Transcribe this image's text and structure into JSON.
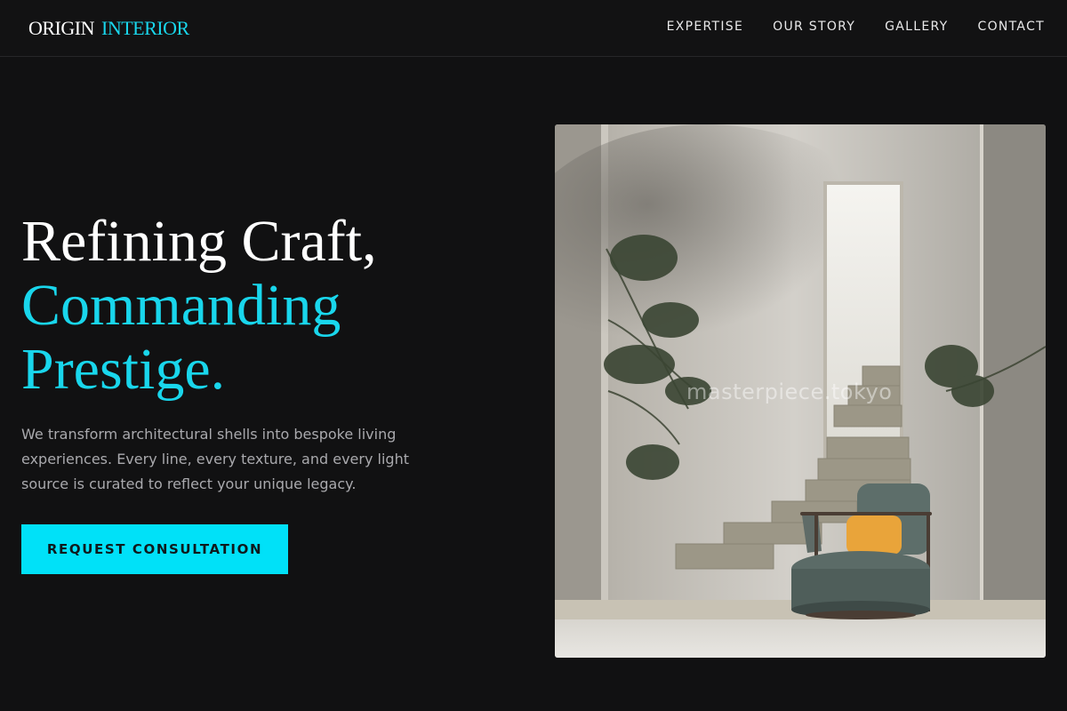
{
  "brand": {
    "name_part1": "ORIGIN",
    "name_part2": "INTERIOR",
    "accent_color": "#19d6ec"
  },
  "nav": {
    "items": [
      {
        "label": "EXPERTISE"
      },
      {
        "label": "OUR STORY"
      },
      {
        "label": "GALLERY"
      },
      {
        "label": "CONTACT"
      }
    ]
  },
  "hero": {
    "title_line1": "Refining Craft,",
    "title_line2": "Commanding",
    "title_line3": "Prestige.",
    "description": "We transform architectural shells into bespoke living experiences. Every line, every texture, and every light source is curated to reflect your unique legacy.",
    "cta_label": "REQUEST CONSULTATION",
    "cta_color": "#00e1f8"
  },
  "image": {
    "watermark": "masterpiece.tokyo"
  }
}
